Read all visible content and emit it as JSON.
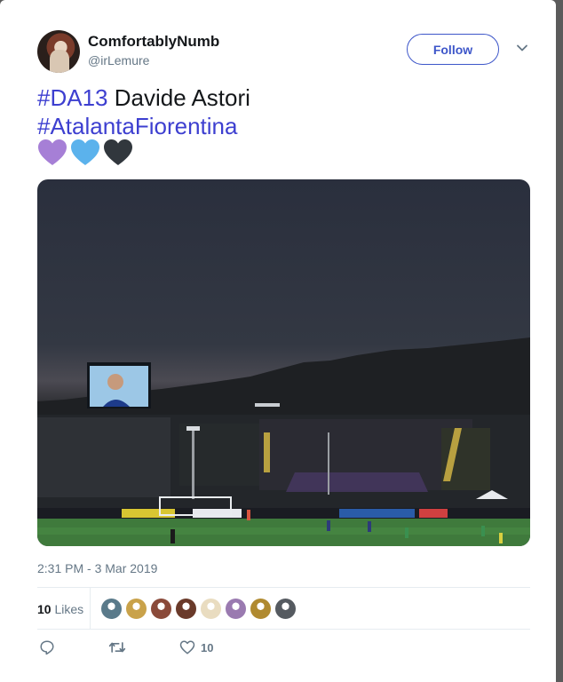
{
  "author": {
    "display_name": "ComfortablyNumb",
    "handle": "@irLemure"
  },
  "follow_label": "Follow",
  "tweet": {
    "hashtag1": "#DA13",
    "text1": " Davide Astori",
    "hashtag2": "#AtalantaFiorentina",
    "hearts": [
      "purple-heart-icon",
      "blue-heart-icon",
      "black-heart-icon"
    ]
  },
  "timestamp": "2:31 PM - 3 Mar 2019",
  "likes": {
    "count": "10",
    "label": "Likes",
    "avatar_colors": [
      "#5a7a8a",
      "#c9a24a",
      "#8a4a3a",
      "#6a3a2a",
      "#e9dcc0",
      "#9a7ab0",
      "#b08a30",
      "#555a60"
    ]
  },
  "actions": {
    "reply_icon": "reply-icon",
    "retweet_icon": "retweet-icon",
    "like_icon": "heart-icon",
    "like_count": "10"
  },
  "colors": {
    "accent": "#3d56c9",
    "hashtag": "#3d3fd0",
    "purple_heart": "#a67fd6",
    "blue_heart": "#5bb2ec",
    "black_heart": "#31373d"
  }
}
